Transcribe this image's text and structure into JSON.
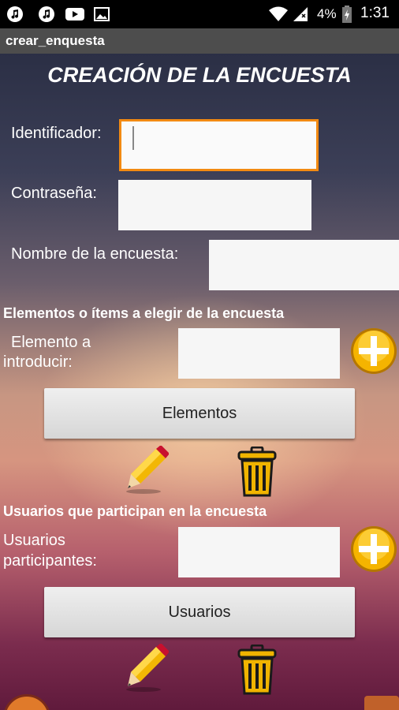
{
  "status_bar": {
    "battery_percent": "4%",
    "time": "1:31",
    "icons": [
      "music-note-icon",
      "music-note-icon",
      "youtube-icon",
      "image-icon",
      "wifi-icon",
      "signal-icon",
      "battery-charging-icon"
    ]
  },
  "title_bar": {
    "title": "crear_enquesta"
  },
  "form": {
    "heading": "CREACIÓN DE LA ENCUESTA",
    "identifier_label": "Identificador:",
    "identifier_value": "",
    "password_label": "Contraseña:",
    "password_value": "",
    "survey_name_label": "Nombre de la encuesta:",
    "survey_name_value": ""
  },
  "elements_section": {
    "title": "Elementos o ítems a elegir de la encuesta",
    "input_label_line1": "Elemento a",
    "input_label_line2": "introducir:",
    "input_value": "",
    "list_button": "Elementos",
    "icons": [
      "add-icon",
      "edit-pencil-icon",
      "trash-icon"
    ]
  },
  "users_section": {
    "title": "Usuarios que participan en la encuesta",
    "input_label_line1": "Usuarios",
    "input_label_line2": "participantes:",
    "input_value": "",
    "list_button": "Usuarios",
    "icons": [
      "add-icon",
      "edit-pencil-icon",
      "trash-icon"
    ]
  },
  "colors": {
    "accent_focus": "#f28a12",
    "title_bar": "#4d4d4d",
    "plus_button": "#f5b400",
    "trash": "#f0b400"
  }
}
